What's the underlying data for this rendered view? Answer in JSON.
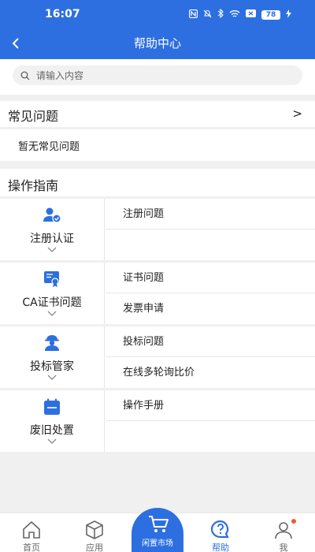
{
  "status_bar": {
    "time": "16:07",
    "battery": "78"
  },
  "nav": {
    "title": "帮助中心"
  },
  "search": {
    "placeholder": "请输入内容"
  },
  "faq": {
    "title": "常见问题",
    "arrow": ">",
    "empty_text": "暂无常见问题"
  },
  "guide": {
    "title": "操作指南",
    "categories": [
      {
        "label": "注册认证",
        "icon": "user-check-icon",
        "items": [
          "注册问题"
        ]
      },
      {
        "label": "CA证书问题",
        "icon": "certificate-icon",
        "items": [
          "证书问题",
          "发票申请"
        ]
      },
      {
        "label": "投标管家",
        "icon": "manager-icon",
        "items": [
          "投标问题",
          "在线多轮询比价"
        ]
      },
      {
        "label": "废旧处置",
        "icon": "calendar-icon",
        "items": [
          "操作手册"
        ]
      }
    ]
  },
  "tabbar": {
    "tabs": [
      {
        "label": "首页",
        "icon": "home-icon"
      },
      {
        "label": "应用",
        "icon": "box-icon"
      },
      {
        "label": "闲置市场",
        "icon": "cart-icon"
      },
      {
        "label": "帮助",
        "icon": "help-icon"
      },
      {
        "label": "我",
        "icon": "person-icon"
      }
    ],
    "active": "帮助"
  },
  "colors": {
    "primary": "#2d6fe0",
    "badge": "#f05a3a",
    "background": "#f0f0f0"
  }
}
